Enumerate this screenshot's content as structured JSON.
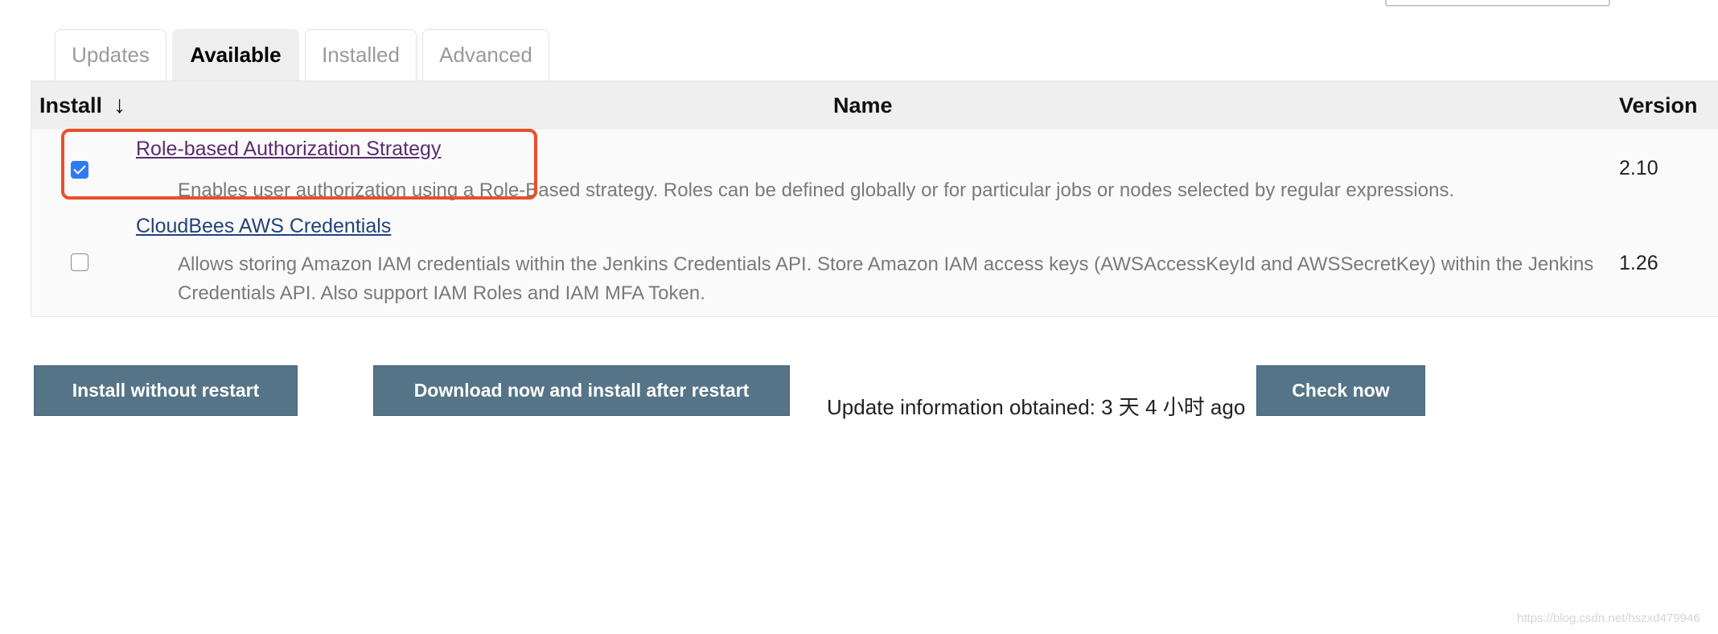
{
  "tabs": [
    {
      "label": "Updates",
      "active": false
    },
    {
      "label": "Available",
      "active": true
    },
    {
      "label": "Installed",
      "active": false
    },
    {
      "label": "Advanced",
      "active": false
    }
  ],
  "table": {
    "columns": {
      "install": "Install",
      "sort_indicator": "↓",
      "name": "Name",
      "version": "Version"
    },
    "rows": [
      {
        "checked": true,
        "name": "Role-based Authorization Strategy",
        "description": "Enables user authorization using a Role-Based strategy. Roles can be defined globally or for particular jobs or nodes selected by regular expressions.",
        "version": "2.10"
      },
      {
        "checked": false,
        "name": "CloudBees AWS Credentials",
        "description": "Allows storing Amazon IAM credentials within the Jenkins Credentials API. Store Amazon IAM access keys (AWSAccessKeyId and AWSSecretKey) within the Jenkins Credentials API. Also support IAM Roles and IAM MFA Token.",
        "version": "1.26"
      }
    ]
  },
  "actions": {
    "install_without_restart": "Install without restart",
    "download_install_after_restart": "Download now and install after restart",
    "update_info": "Update information obtained: 3 天 4 小时 ago",
    "check_now": "Check now"
  },
  "watermark": "https://blog.csdn.net/hszxd479946",
  "colors": {
    "button_bg": "#557487",
    "highlight_border": "#e8502a",
    "checkbox_checked": "#2f7bf5"
  }
}
